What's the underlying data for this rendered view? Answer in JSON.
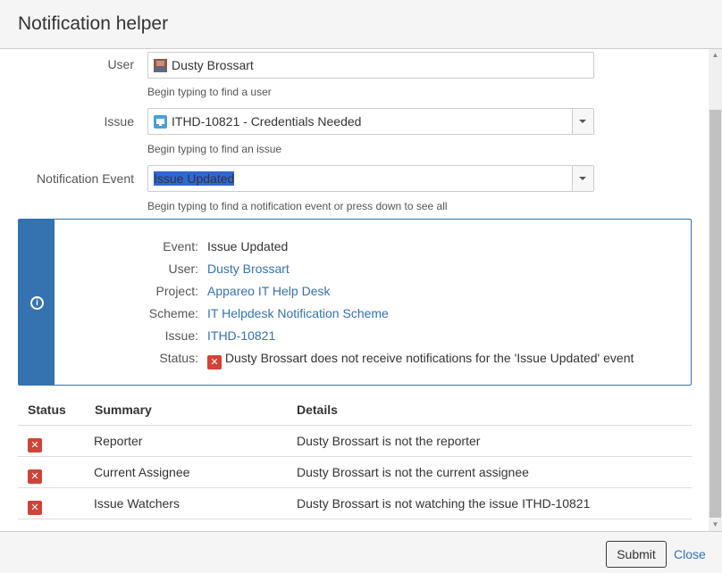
{
  "dialog": {
    "title": "Notification helper"
  },
  "form": {
    "user": {
      "label": "User",
      "value": "Dusty Brossart",
      "hint": "Begin typing to find a user"
    },
    "issue": {
      "label": "Issue",
      "value": "ITHD-10821 - Credentials Needed",
      "hint": "Begin typing to find an issue"
    },
    "event": {
      "label": "Notification Event",
      "value": "Issue Updated",
      "hint": "Begin typing to find a notification event or press down to see all"
    }
  },
  "info": {
    "event": {
      "label": "Event:",
      "value": "Issue Updated"
    },
    "user": {
      "label": "User:",
      "value": "Dusty Brossart"
    },
    "project": {
      "label": "Project:",
      "value": "Appareo IT Help Desk"
    },
    "scheme": {
      "label": "Scheme:",
      "value": "IT Helpdesk Notification Scheme"
    },
    "issue": {
      "label": "Issue:",
      "value": "ITHD-10821"
    },
    "status": {
      "label": "Status:",
      "value": "Dusty Brossart does not receive notifications for the 'Issue Updated' event"
    }
  },
  "table": {
    "headers": {
      "status": "Status",
      "summary": "Summary",
      "details": "Details"
    },
    "rows": [
      {
        "summary": "Reporter",
        "details": "Dusty Brossart is not the reporter"
      },
      {
        "summary": "Current Assignee",
        "details": "Dusty Brossart is not the current assignee"
      },
      {
        "summary": "Issue Watchers",
        "details": "Dusty Brossart is not watching the issue ITHD-10821"
      }
    ]
  },
  "footer": {
    "submit_label": "Submit",
    "close_label": "Close"
  },
  "icons": {
    "error": "x-icon",
    "info": "info-icon",
    "user": "user-avatar",
    "issue": "issue-type-icon",
    "dropdown": "chevron-down-icon"
  },
  "colors": {
    "accent": "#3572b0",
    "error": "#d04437",
    "selection": "#3067d6"
  }
}
